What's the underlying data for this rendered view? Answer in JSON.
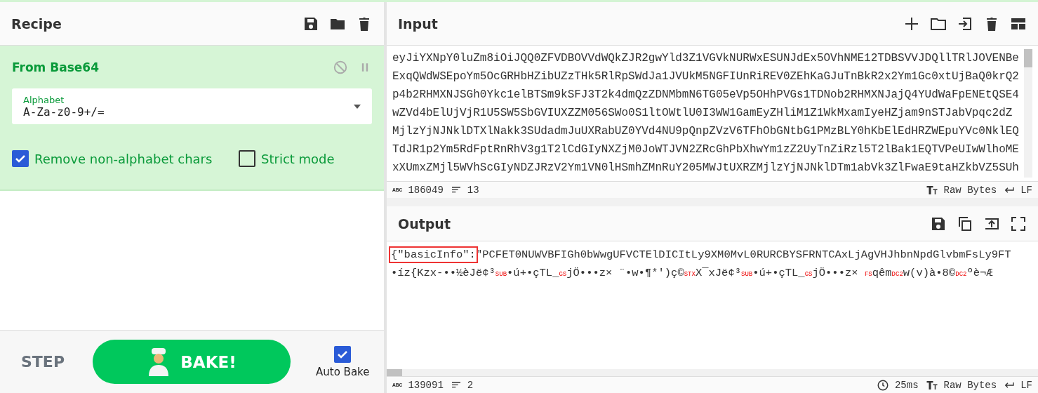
{
  "recipe": {
    "title": "Recipe",
    "operation": {
      "name": "From Base64",
      "disabled": false,
      "paused": false,
      "alphabet": {
        "label": "Alphabet",
        "value": "A-Za-z0-9+/="
      },
      "options": [
        {
          "label": "Remove non-alphabet chars",
          "checked": true
        },
        {
          "label": "Strict mode",
          "checked": false
        }
      ]
    }
  },
  "controls": {
    "step": "STEP",
    "bake": "BAKE!",
    "auto_bake": {
      "label": "Auto Bake",
      "checked": true
    }
  },
  "input": {
    "title": "Input",
    "lines": [
      "eyJiYXNpY0luZm8iOiJQQ0ZFVDBOVVdWQkZJR2gwYld3Z1VGVkNURWxESUNJdEx5OVhNME12TDBSVVJDQllTRlJOVENBe",
      "ExqQWdWSEpoYm5OcGRHbHZibUZzTHk5RlRpSWdJa1JVUkM5NGFIUnRiREV0ZEhKaGJuTnBkR2x2Ym1Gc0xtUjBaQ0krQ2",
      "p4b2RHMXNJSGh0Ykc1elBTSm9kSFJ3T2k4dmQzZDNMbmN6TG05eVp5OHhPVGs1TDNob2RHMXNJajQ4YUdWaFpENEtQSE4",
      "wZVd4bElUjVjR1U5SW5SbGVIUXZZM056SWo0S1ltOWtlU0I3WW1GamEyZHliM1Z1WkMxamIyeHZjam9nSTJabVpqc2dZ",
      "MjlzYjNJNklDTXlNakk3SUdadmJuUXRabUZ0YVd4NU9pQnpZVzV6TFhObGNtbG1PMzBLY0hKbElEdHRZWEpuYVc0NklEQ",
      "TdJR1p2Ym5RdFptRnRhV3g1T2lCdGIyNXZjM0JoWTJVN2ZRcGhPbXhwYm1zZ2UyTnZiRzl5T2lBak1EQTVPeUIwWlhoME",
      "xXUmxZMjl5WVhScGIyNDZJRzV2Ym1VN0lHSmhZMnRuY205MWJtUXRZMjlzYjNJNklDTm1abVk3ZlFwaE9taHZkbVZ5SUh"
    ],
    "length_label": "ABC",
    "length": "186049",
    "line_count": "13",
    "encoding": "Raw Bytes",
    "eol": "LF"
  },
  "output": {
    "title": "Output",
    "highlight": "{\"basicInfo\":",
    "line_1": "\"PCFET0NUWVBFIGh0bWwgUFVCTElDICItLy9XM0MvL0RURCBYSFRNTCAxLjAgVHJhbnNpdGlvbmFsLy9FT",
    "line_2": [
      {
        "kind": "text",
        "text": "•íz{Kzx-••½èJë¢³"
      },
      {
        "kind": "control",
        "text": "SUB"
      },
      {
        "kind": "text",
        "text": "•ú+•çTL_"
      },
      {
        "kind": "control",
        "text": "GS"
      },
      {
        "kind": "text",
        "text": "jÖ•••z× ¨•w•¶*')ç©"
      },
      {
        "kind": "control",
        "text": "STX"
      },
      {
        "kind": "text",
        "text": "X¯xJë¢³"
      },
      {
        "kind": "control",
        "text": "SUB"
      },
      {
        "kind": "text",
        "text": "•ú+•çTL_"
      },
      {
        "kind": "control",
        "text": "GS"
      },
      {
        "kind": "text",
        "text": "jÖ•••z× "
      },
      {
        "kind": "control",
        "text": "FS"
      },
      {
        "kind": "text",
        "text": "qêm"
      },
      {
        "kind": "control",
        "text": "DC2"
      },
      {
        "kind": "text",
        "text": "w(v)à•8©"
      },
      {
        "kind": "control",
        "text": "DC2"
      },
      {
        "kind": "text",
        "text": "ºè¬Æ"
      }
    ],
    "length_label": "ABC",
    "length": "139091",
    "line_count": "2",
    "time": "25ms",
    "encoding": "Raw Bytes",
    "eol": "LF"
  }
}
